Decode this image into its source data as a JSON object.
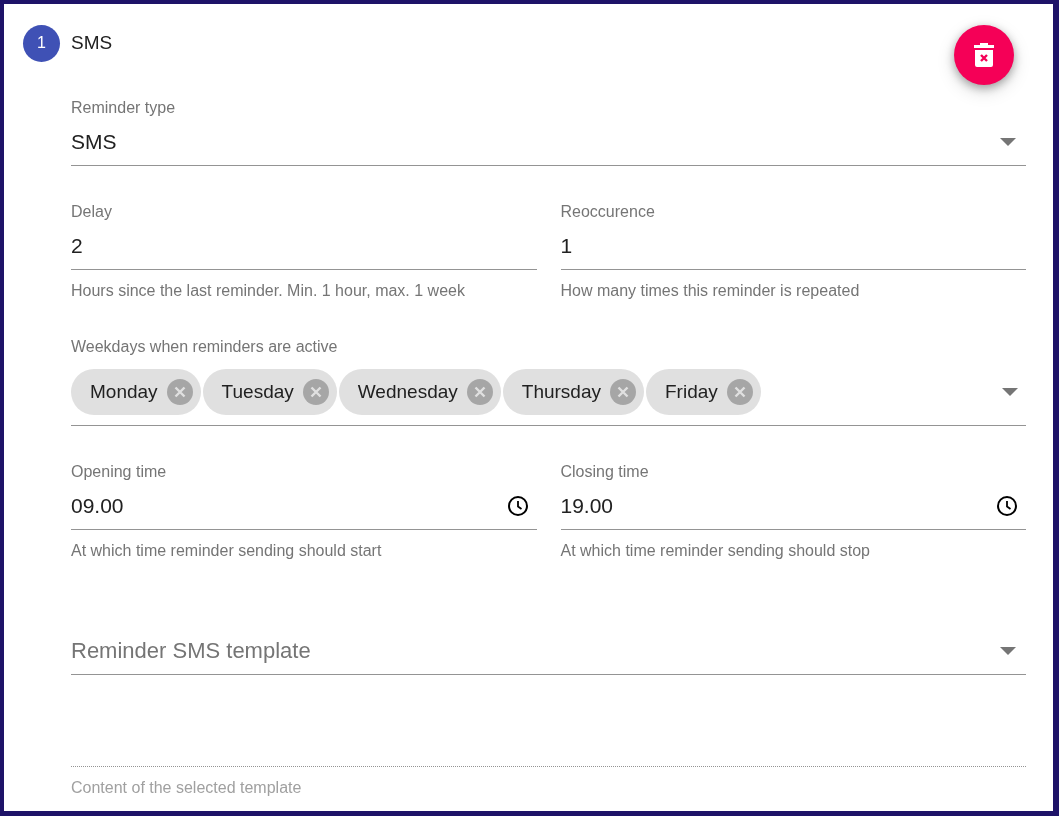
{
  "step": {
    "number": "1",
    "title": "SMS"
  },
  "rows": [
    [
      {
        "kind": "select",
        "label": "Reminder type",
        "value": "SMS"
      }
    ],
    [
      {
        "kind": "text",
        "label": "Delay",
        "value": "2",
        "hint": "Hours since the last reminder. Min. 1 hour, max. 1 week"
      },
      {
        "kind": "text",
        "label": "Reoccurence",
        "value": "1",
        "hint": "How many times this reminder is repeated"
      }
    ],
    [
      {
        "kind": "chips",
        "label": "Weekdays when reminders are active",
        "chips": [
          {
            "label": "Monday"
          },
          {
            "label": "Tuesday"
          },
          {
            "label": "Wednesday"
          },
          {
            "label": "Thursday"
          },
          {
            "label": "Friday"
          }
        ]
      }
    ],
    [
      {
        "kind": "time",
        "label": "Opening time",
        "value": "09.00",
        "hint": "At which time reminder sending should start"
      },
      {
        "kind": "time",
        "label": "Closing time",
        "value": "19.00",
        "hint": "At which time reminder sending should stop"
      }
    ],
    [
      {
        "kind": "select",
        "placeholder": "Reminder SMS template"
      }
    ],
    [
      {
        "kind": "textarea",
        "disabled": true,
        "hint": "Content of the selected template"
      }
    ]
  ]
}
